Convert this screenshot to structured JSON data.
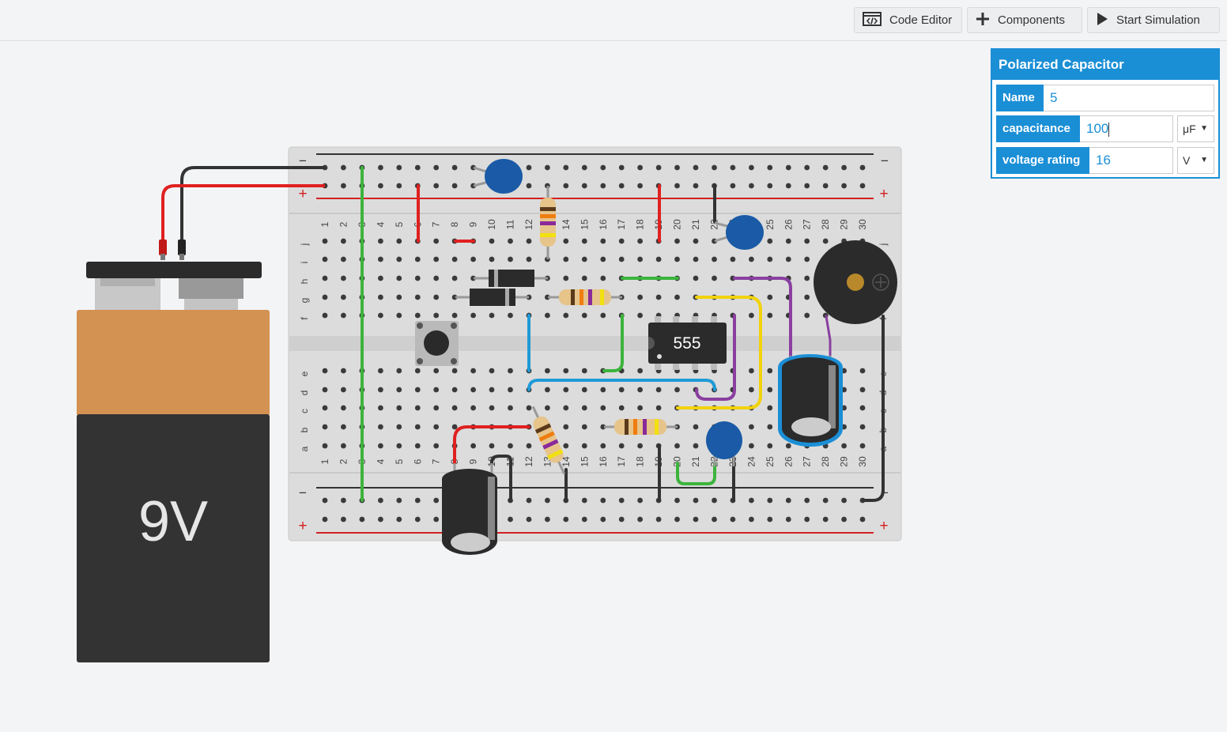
{
  "toolbar": {
    "code_editor_label": "Code Editor",
    "components_label": "Components",
    "start_simulation_label": "Start Simulation"
  },
  "inspector": {
    "title": "Polarized Capacitor",
    "name_label": "Name",
    "name_value": "5",
    "capacitance_label": "capacitance",
    "capacitance_value": "100",
    "capacitance_unit": "μF",
    "voltage_label": "voltage rating",
    "voltage_value": "16",
    "voltage_unit": "V"
  },
  "battery": {
    "label": "9V"
  },
  "chip": {
    "label": "555"
  },
  "breadboard": {
    "row_letters_top": [
      "j",
      "i",
      "h",
      "g",
      "f"
    ],
    "row_letters_bottom": [
      "e",
      "d",
      "c",
      "b",
      "a"
    ],
    "column_numbers": [
      "1",
      "2",
      "3",
      "4",
      "5",
      "6",
      "7",
      "8",
      "9",
      "10",
      "11",
      "12",
      "13",
      "14",
      "15",
      "16",
      "17",
      "18",
      "19",
      "20",
      "21",
      "22",
      "23",
      "24",
      "25",
      "26",
      "27",
      "28",
      "29",
      "30"
    ],
    "rail_minus": "−",
    "rail_plus": "+"
  },
  "colors": {
    "accent": "#1b8fd6",
    "wire_red": "#e02020",
    "wire_black": "#333333",
    "wire_green": "#3cb43c",
    "wire_blue": "#1f9ad6",
    "wire_yellow": "#f2d20c",
    "wire_purple": "#8a3fa0",
    "battery_top": "#d39152",
    "battery_body": "#333333",
    "ceramic_cap": "#1a5aa6"
  },
  "icons": [
    "code-editor-icon",
    "plus-icon",
    "play-icon"
  ]
}
